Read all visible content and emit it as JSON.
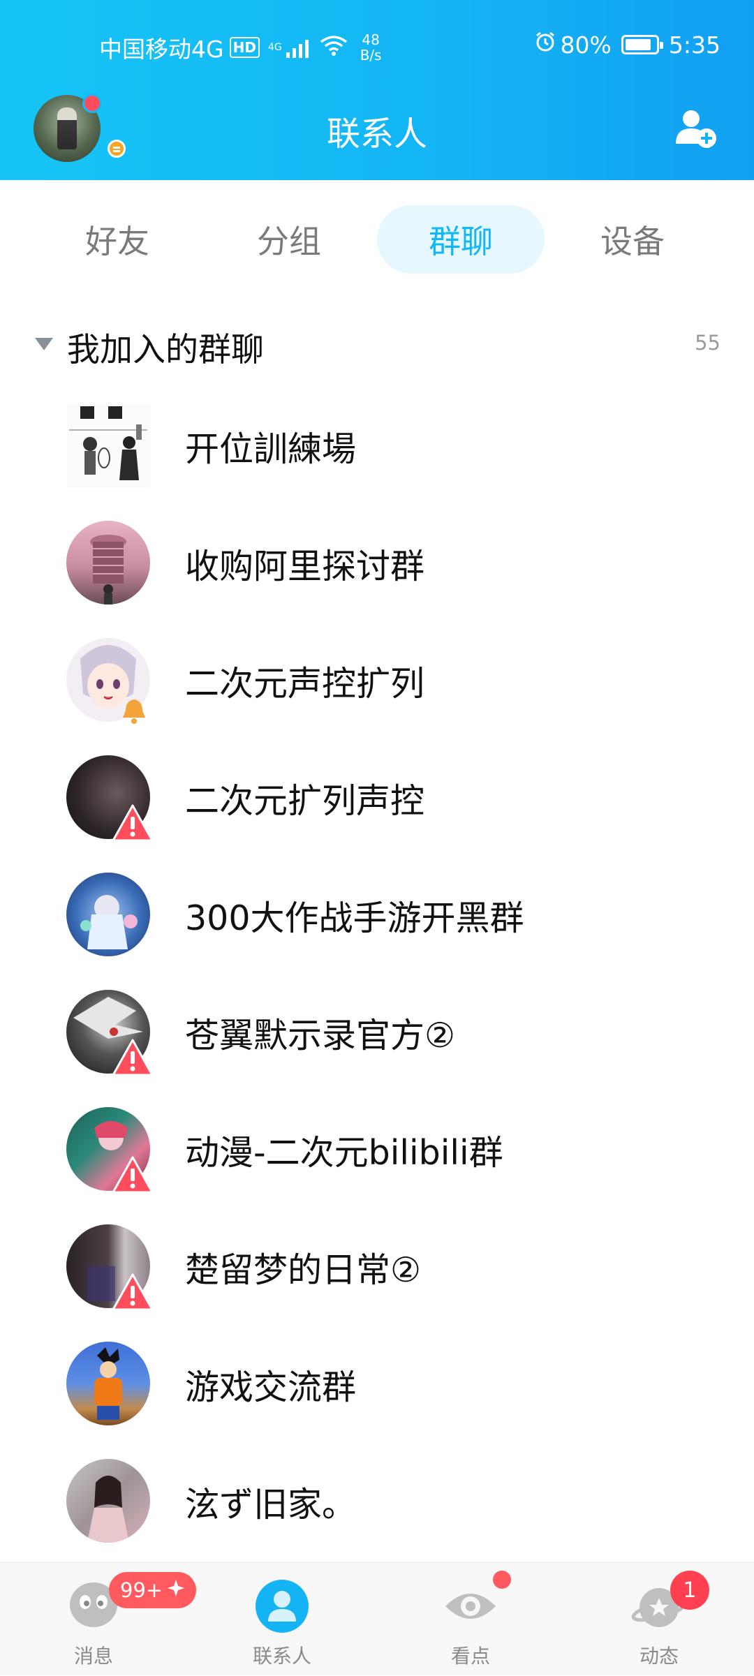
{
  "status_bar": {
    "carrier": "中国移动4G",
    "hd": "HD",
    "network_badge": "4G",
    "speed_value": "48",
    "speed_unit": "B/s",
    "battery": "80%",
    "time": "5:35"
  },
  "header": {
    "title": "联系人"
  },
  "tabs": [
    {
      "label": "好友"
    },
    {
      "label": "分组"
    },
    {
      "label": "群聊",
      "active": true
    },
    {
      "label": "设备"
    }
  ],
  "section": {
    "title": "我加入的群聊",
    "count": "55"
  },
  "groups": [
    {
      "name": "开位訓練場"
    },
    {
      "name": "收购阿里探讨群"
    },
    {
      "name": "二次元声控扩列",
      "indicator": "bell"
    },
    {
      "name": "二次元扩列声控",
      "indicator": "warning"
    },
    {
      "name": "300大作战手游开黑群"
    },
    {
      "name": "苍翼默示录官方②",
      "indicator": "warning"
    },
    {
      "name": "动漫-二次元bilibili群",
      "indicator": "warning"
    },
    {
      "name": "楚留梦的日常②",
      "indicator": "warning"
    },
    {
      "name": "游戏交流群"
    },
    {
      "name": "泫ず旧家。"
    }
  ],
  "bottom_nav": {
    "messages": "消息",
    "messages_badge": "99+",
    "contacts": "联系人",
    "kandian": "看点",
    "moments": "动态",
    "moments_badge": "1"
  },
  "colors": {
    "accent": "#12b7f5",
    "badge": "#ff5a5f",
    "warning": "#ff4d5e"
  }
}
